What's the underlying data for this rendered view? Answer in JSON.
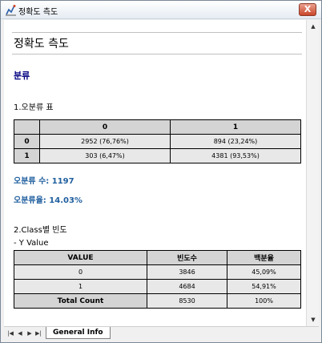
{
  "window": {
    "title": "정확도 측도",
    "close_glyph": "X"
  },
  "report": {
    "title": "정확도 측도",
    "section": "분류",
    "confusion": {
      "heading": "1.오분류 표",
      "col_headers": [
        "0",
        "1"
      ],
      "rows": [
        {
          "label": "0",
          "cells": [
            "2952 (76,76%)",
            "894 (23,24%)"
          ]
        },
        {
          "label": "1",
          "cells": [
            "303 (6,47%)",
            "4381 (93,53%)"
          ]
        }
      ]
    },
    "misclass_count": "오분류 수: 1197",
    "misclass_rate": "오분류율: 14.03%",
    "frequency": {
      "heading": "2.Class별 빈도",
      "variable": "- Y Value",
      "headers": [
        "VALUE",
        "빈도수",
        "백분율"
      ],
      "rows": [
        [
          "0",
          "3846",
          "45,09%"
        ],
        [
          "1",
          "4684",
          "54,91%"
        ]
      ],
      "total_row": [
        "Total Count",
        "8530",
        "100%"
      ]
    }
  },
  "sheets": {
    "active_tab": "General Info",
    "nav": [
      "first",
      "prev",
      "next",
      "last"
    ]
  },
  "icons": {
    "app": "chart-app-icon",
    "close": "close-icon",
    "scroll_up": "scroll-up-arrow-icon",
    "scroll_down": "scroll-down-arrow-icon",
    "nav_first": "first-sheet-icon",
    "nav_prev": "prev-sheet-icon",
    "nav_next": "next-sheet-icon",
    "nav_last": "last-sheet-icon"
  },
  "colors": {
    "section_heading": "#000080",
    "stat_text": "#1f5f9f",
    "header_fill": "#d4d4d4",
    "cell_fill": "#e8e8e8",
    "close_button": "#c9472b"
  }
}
